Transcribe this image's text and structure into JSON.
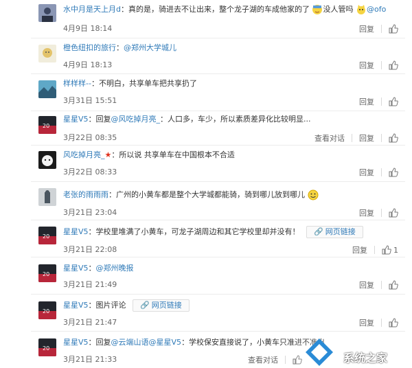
{
  "actions": {
    "reply": "回复",
    "view_dialog": "查看对话"
  },
  "web_link_label": "网页链接",
  "comments": [
    {
      "user": "水中月是天上月d",
      "text": "：真的是，骑进去不让出来，整个龙子湖的车成他家的了",
      "text2": "没人管吗",
      "mention": "@ofo",
      "time": "4月9日 18:14"
    },
    {
      "user": "橙色纽扣的旅行",
      "text": "：",
      "mention": "@郑州大学城儿",
      "time": "4月9日 18:13"
    },
    {
      "user": "样样样--",
      "text": "：不明白，共享单车把共享扔了",
      "time": "3月31日 15:51"
    },
    {
      "user": "星星V5",
      "prefix": "：回复",
      "mention": "@风吃掉月亮_",
      "text": "：人口多，车少，所以素质差异化比较明显...",
      "time": "3月22日 08:35"
    },
    {
      "user": "风吃掉月亮_",
      "text": "：所以说 共享单车在中国根本不合适",
      "time": "3月22日 08:33"
    },
    {
      "user": "老张的雨雨雨",
      "text": "：广州的小黄车都是整个大学城都能骑，骑到哪儿放到哪儿",
      "time": "3月21日 23:04"
    },
    {
      "user": "星星V5",
      "text": "：学校里堆满了小黄车，可龙子湖周边和其它学校里却并没有！",
      "time": "3月21日 22:08",
      "likes": "1"
    },
    {
      "user": "星星V5",
      "text": "：",
      "mention": "@郑州晚报",
      "time": "3月21日 21:49"
    },
    {
      "user": "星星V5",
      "text": "：图片评论",
      "time": "3月21日 21:47"
    },
    {
      "user": "星星V5",
      "prefix": "：回复",
      "mention": "@云端山语",
      "mention2": "@星星V5",
      "text": "：学校保安直接说了，小黄车只准进不准出",
      "time": "3月21日 21:33"
    }
  ],
  "watermark": {
    "text": "系统之家"
  },
  "colors": {
    "link": "#2f7ab8",
    "divider": "#ececec"
  }
}
